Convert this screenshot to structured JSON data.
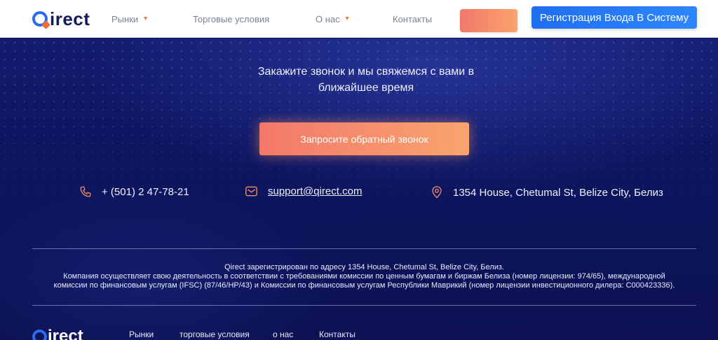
{
  "header": {
    "logo_text": "irect",
    "nav": [
      {
        "label": "Рынки",
        "has_dropdown": true
      },
      {
        "label": "Торговые условия",
        "has_dropdown": false
      },
      {
        "label": "О нас",
        "has_dropdown": true
      },
      {
        "label": "Контакты",
        "has_dropdown": false
      }
    ],
    "register_label": "Регистрация Входа В Систему"
  },
  "callback": {
    "tagline_line1": "Закажите звонок и мы свяжемся с вами в",
    "tagline_line2": "ближайшее время",
    "button_label": "Запросите обратный звонок"
  },
  "contacts": {
    "phone": "+ (501) 2 47-78-21",
    "email": "support@qirect.com",
    "address": "1354 House, Chetumal St, Belize City, Белиз"
  },
  "legal": {
    "line1": "Qirect зарегистрирован по адресу 1354 House, Chetumal St, Belize City, Белиз.",
    "line2": "Компания осуществляет свою деятельность в соответствии с требованиями комиссии по ценным бумагам и биржам Белиза (номер лицензии: 974/65), международной",
    "line3": "комиссии по финансовым услугам (IFSC) (87/46/HP/43) и Комиссии по финансовым услугам Республики Маврикий (номер лицензии инвестиционного дилера: C000423336)."
  },
  "footer": {
    "logo_text": "irect",
    "nav": [
      "Рынки",
      "торговые условия",
      "о нас",
      "Контакты"
    ]
  },
  "colors": {
    "brand_blue": "#2b6bf2",
    "accent_orange": "#f3786a",
    "background_navy": "#0c1256"
  }
}
